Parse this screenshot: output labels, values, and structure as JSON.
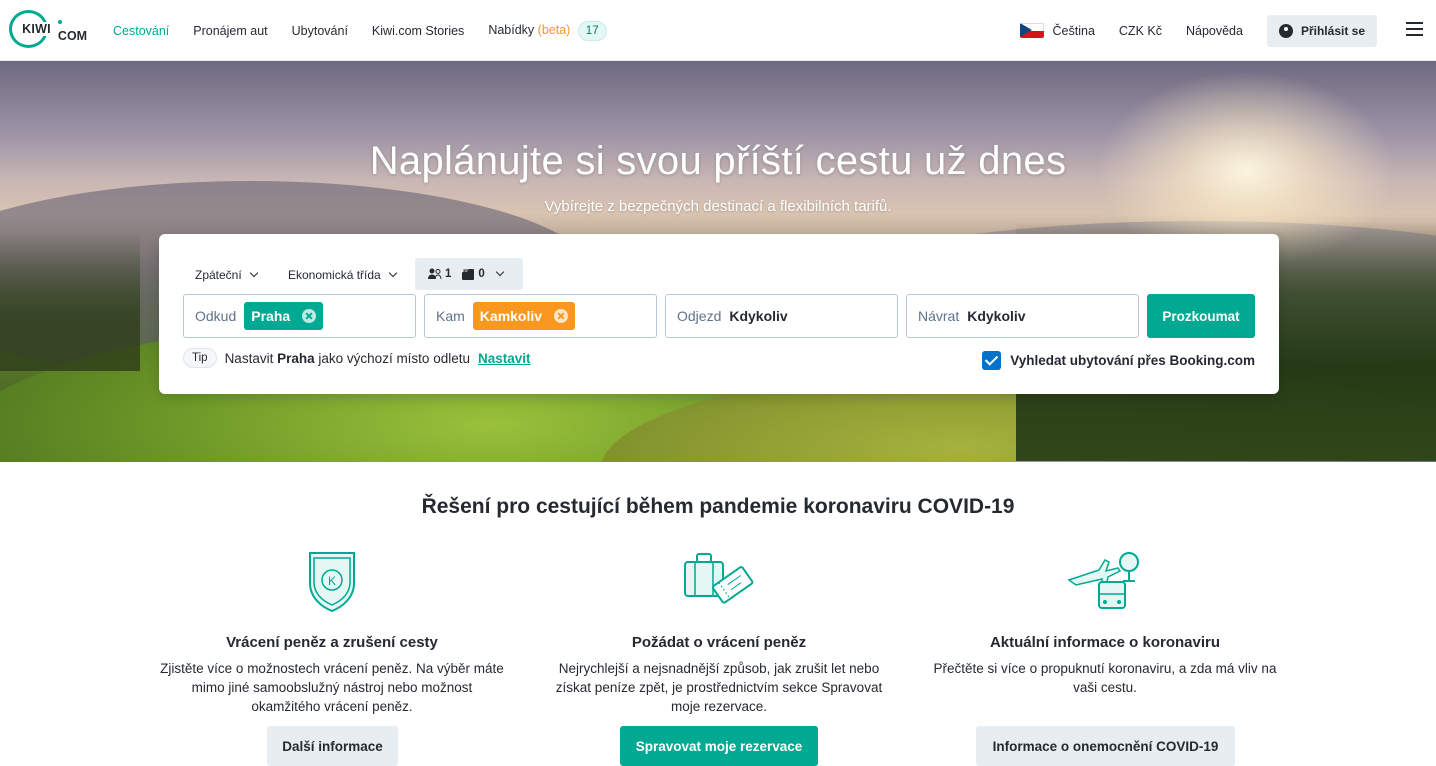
{
  "header": {
    "logo_text": "KIWI",
    "logo_suffix": "COM",
    "nav": [
      {
        "label": "Cestování",
        "active": true
      },
      {
        "label": "Pronájem aut"
      },
      {
        "label": "Ubytování"
      },
      {
        "label": "Kiwi.com Stories"
      }
    ],
    "offers_label": "Nabídky",
    "offers_beta": "(beta)",
    "offers_count": "17",
    "language": "Čeština",
    "currency": "CZK Kč",
    "help": "Nápověda",
    "login": "Přihlásit se"
  },
  "hero": {
    "title": "Naplánujte si svou příští cestu už dnes",
    "subtitle": "Vybírejte z bezpečných destinací a flexibilních tarifů."
  },
  "search": {
    "trip_type": "Zpáteční",
    "cabin_class": "Ekonomická třída",
    "passengers": "1",
    "bags": "0",
    "from_label": "Odkud",
    "from_value": "Praha",
    "to_label": "Kam",
    "to_value": "Kamkoliv",
    "depart_label": "Odjezd",
    "depart_value": "Kdykoliv",
    "return_label": "Návrat",
    "return_value": "Kdykoliv",
    "submit": "Prozkoumat",
    "tip_badge": "Tip",
    "tip_text_1": "Nastavit",
    "tip_bold": "Praha",
    "tip_text_2": "jako výchozí místo odletu",
    "tip_link": "Nastavit",
    "booking_checkbox": "Vyhledat ubytování přes Booking.com",
    "booking_checked": true
  },
  "covid": {
    "title": "Řešení pro cestující během pandemie koronaviru COVID-19",
    "columns": [
      {
        "icon": "shield-k-icon",
        "title": "Vrácení peněz a zrušení cesty",
        "text": "Zjistěte více o možnostech vrácení peněz. Na výběr máte mimo jiné samoobslužný nástroj nebo možnost okamžitého vrácení peněz.",
        "button": "Další informace"
      },
      {
        "icon": "luggage-ticket-icon",
        "title": "Požádat o vrácení peněz",
        "text": "Nejrychlejší a nejsnadnější způsob, jak zrušit let nebo získat peníze zpět, je prostřednictvím sekce Spravovat moje rezervace.",
        "button": "Spravovat moje rezervace"
      },
      {
        "icon": "plane-bus-icon",
        "title": "Aktuální informace o koronaviru",
        "text": "Přečtěte si více o propuknutí koronaviru, a zda má vliv na vaši cestu.",
        "button": "Informace o onemocnění COVID-19"
      }
    ]
  },
  "colors": {
    "brand": "#00a991",
    "accent_orange": "#f9971e",
    "checkbox_blue": "#0172cb"
  }
}
